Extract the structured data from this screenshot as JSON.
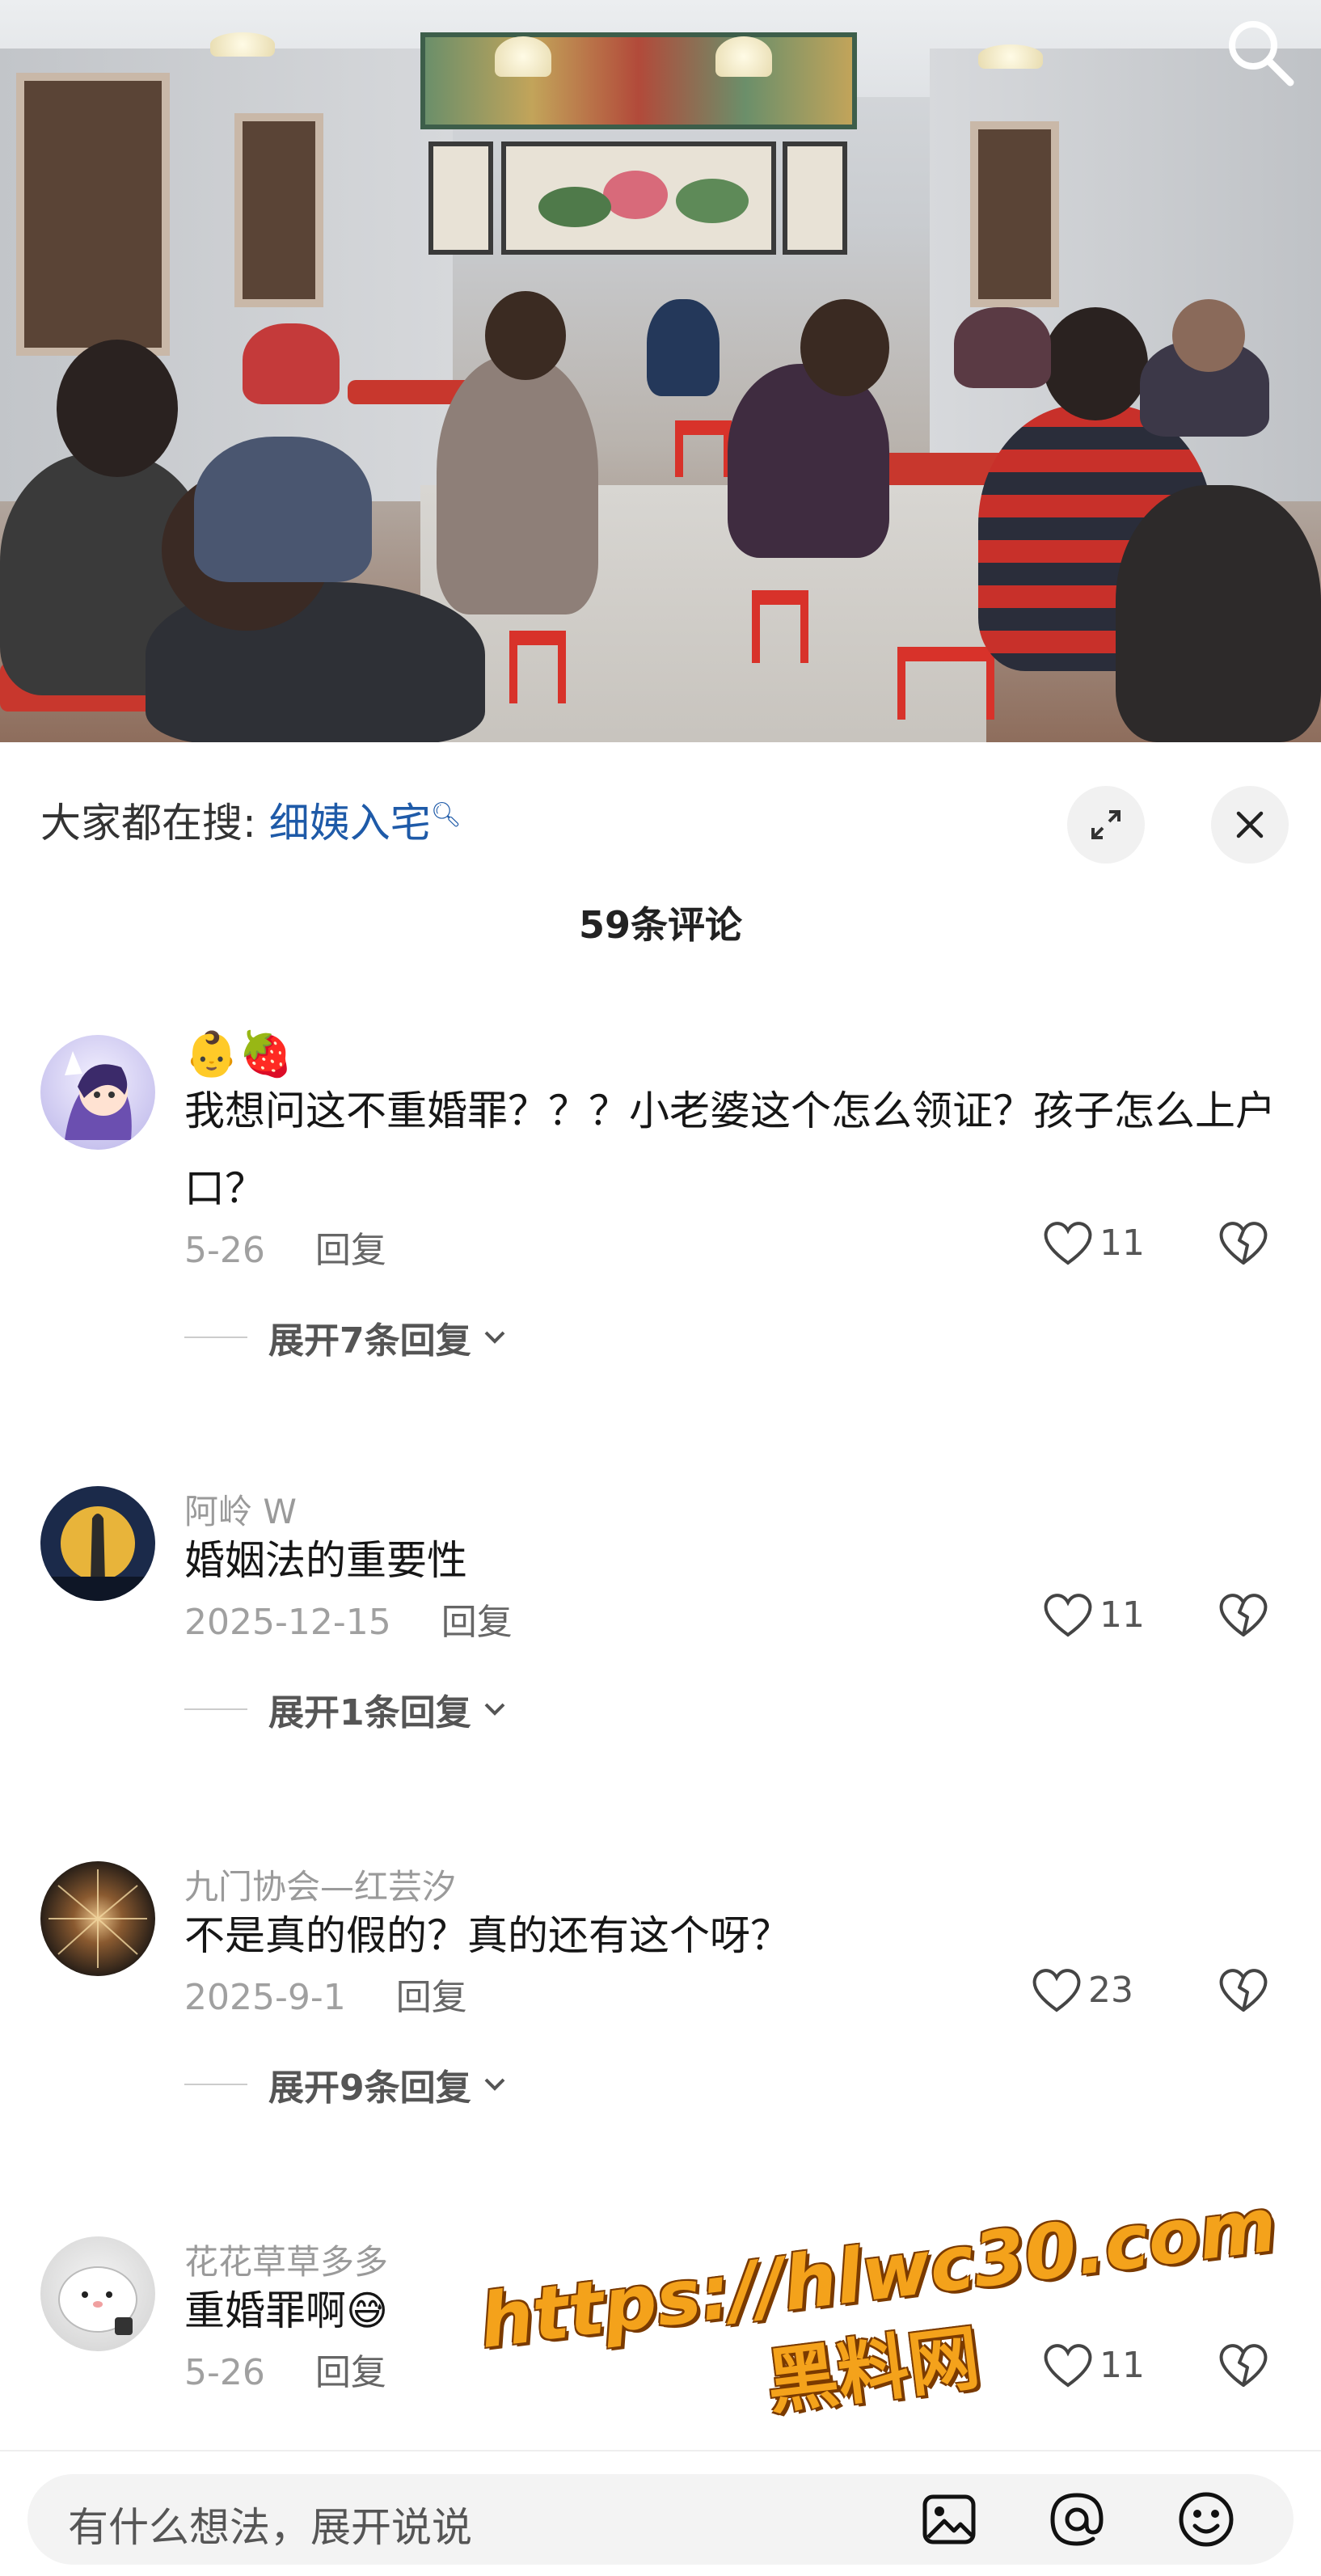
{
  "video": {
    "description_icon": "search-icon"
  },
  "sheet": {
    "search_prefix": "大家都在搜:",
    "search_term": "细姨入宅",
    "search_term_icon": "search-icon",
    "comment_count": "59条评论"
  },
  "comments": [
    {
      "name": "",
      "emojis": "👶🍓",
      "text": "我想问这不重婚罪？？？小老婆这个怎么领证？孩子怎么上户口？",
      "date": "5-26",
      "reply": "回复",
      "likes": "11",
      "expand": "展开7条回复"
    },
    {
      "name": "阿岭 W",
      "text": "婚姻法的重要性",
      "date": "2025-12-15",
      "reply": "回复",
      "likes": "11",
      "expand": "展开1条回复"
    },
    {
      "name": "九门协会—红芸汐",
      "text": "不是真的假的？真的还有这个呀？",
      "date": "2025-9-1",
      "reply": "回复",
      "likes": "23",
      "expand": "展开9条回复"
    },
    {
      "name": "花花草草多多",
      "text": "重婚罪啊😅",
      "date": "5-26",
      "reply": "回复",
      "likes": "11"
    }
  ],
  "watermark": {
    "url": "https://hlwc30.com",
    "brand": "黑料网"
  },
  "input": {
    "placeholder": "有什么想法，展开说说"
  },
  "colors": {
    "link": "#1e5aa8",
    "watermark": "#f4a21b",
    "table": "#c8372d"
  }
}
